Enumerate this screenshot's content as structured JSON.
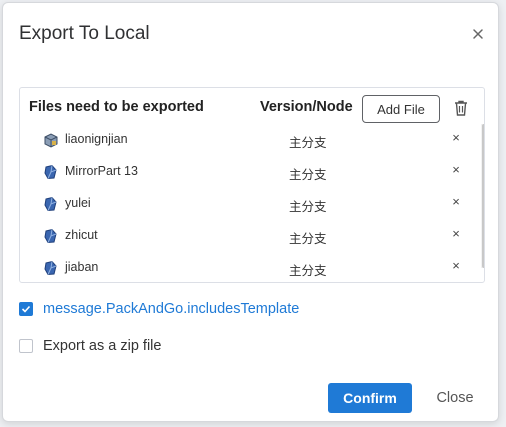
{
  "dialog": {
    "title": "Export To Local",
    "close_icon": "close-icon"
  },
  "files_table": {
    "header_files": "Files need to be exported",
    "header_version": "Version/Node",
    "add_file_label": "Add File",
    "delete_all_icon": "trash-icon",
    "rows": [
      {
        "name": "liaonignjian",
        "version": "主分支",
        "remove": "×",
        "icon": "assembly-icon"
      },
      {
        "name": "MirrorPart 13",
        "version": "主分支",
        "remove": "×",
        "icon": "part-icon"
      },
      {
        "name": "yulei",
        "version": "主分支",
        "remove": "×",
        "icon": "part-icon"
      },
      {
        "name": "zhicut",
        "version": "主分支",
        "remove": "×",
        "icon": "part-icon"
      },
      {
        "name": "jiaban",
        "version": "主分支",
        "remove": "×",
        "icon": "part-icon"
      }
    ]
  },
  "options": {
    "include_template": {
      "label": "message.PackAndGo.includesTemplate",
      "checked": true
    },
    "zip_file": {
      "label": "Export as a zip file",
      "checked": false
    }
  },
  "footer": {
    "confirm_label": "Confirm",
    "close_label": "Close"
  },
  "colors": {
    "accent": "#1f7ad6",
    "part_icon": "#3a66b0"
  }
}
